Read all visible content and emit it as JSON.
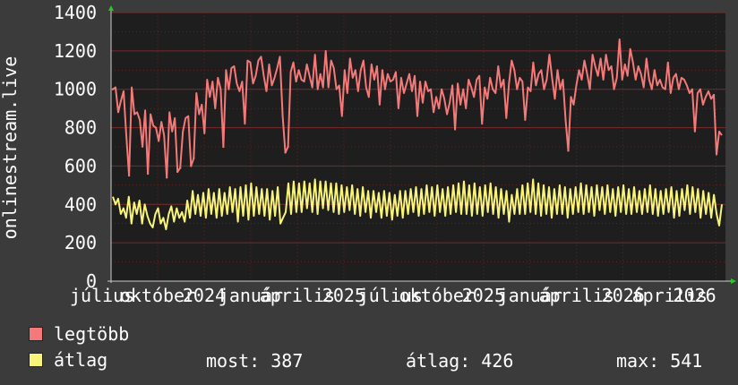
{
  "chart_data": {
    "type": "line",
    "ylabel": "onlinestream.live",
    "ylim": [
      0,
      1400
    ],
    "yticks": [
      0,
      200,
      400,
      600,
      800,
      1000,
      1200,
      1400
    ],
    "xtick_labels": [
      "július",
      "október",
      "2024",
      "január",
      "április",
      "2025",
      "július",
      "október",
      "2025",
      "január",
      "április",
      "2026",
      "április",
      "2026"
    ],
    "grid": true,
    "colors": {
      "background": "#3b3b3b",
      "plot": "#1e1e1e",
      "grid": "#7a2a2a",
      "legtobb": "#f47a7a",
      "atlag": "#f8f47a"
    },
    "series": [
      {
        "name": "legtöbb",
        "key": "legtobb",
        "values": [
          1000,
          1010,
          880,
          940,
          990,
          760,
          550,
          1010,
          870,
          880,
          840,
          700,
          890,
          560,
          870,
          810,
          800,
          730,
          830,
          760,
          540,
          880,
          780,
          850,
          570,
          590,
          780,
          850,
          860,
          600,
          640,
          980,
          870,
          920,
          770,
          1050,
          960,
          1040,
          900,
          1060,
          1000,
          700,
          1100,
          1000,
          1110,
          1120,
          1030,
          990,
          1040,
          820,
          1150,
          1140,
          1030,
          1070,
          1150,
          1170,
          1070,
          990,
          1130,
          1020,
          1060,
          1110,
          1170,
          860,
          670,
          700,
          1090,
          1140,
          1040,
          1100,
          1050,
          1040,
          1130,
          1070,
          1010,
          1180,
          1000,
          1080,
          1010,
          1200,
          1010,
          1150,
          1110,
          1000,
          1020,
          860,
          1100,
          980,
          1160,
          1060,
          1100,
          990,
          1100,
          1150,
          1010,
          960,
          1130,
          1050,
          1120,
          920,
          1100,
          1000,
          1080,
          1040,
          1050,
          1090,
          900,
          1060,
          980,
          1030,
          1080,
          990,
          1070,
          860,
          1040,
          930,
          1040,
          990,
          1000,
          880,
          960,
          900,
          1000,
          950,
          870,
          930,
          1020,
          790,
          1030,
          920,
          1000,
          900,
          1050,
          1010,
          960,
          1050,
          1070,
          820,
          1010,
          950,
          1060,
          1000,
          980,
          1120,
          1010,
          1050,
          850,
          1030,
          1150,
          1100,
          1000,
          1060,
          1040,
          840,
          1010,
          990,
          1140,
          1020,
          1080,
          1100,
          1000,
          1050,
          1180,
          1060,
          950,
          1100,
          1000,
          1050,
          840,
          680,
          960,
          920,
          1020,
          1100,
          1050,
          1150,
          1080,
          1000,
          1180,
          1120,
          1070,
          1160,
          1050,
          1180,
          1100,
          1120,
          1000,
          1060,
          1260,
          1050,
          1130,
          1070,
          1210,
          1140,
          1050,
          1120,
          1080,
          1010,
          1160,
          1050,
          1000,
          1100,
          1020,
          1050,
          1010,
          1000,
          1140,
          980,
          1060,
          1080,
          1000,
          1060,
          1050,
          1020,
          980,
          1000,
          780,
          980,
          1000,
          920,
          960,
          990,
          950,
          970,
          660,
          780,
          760
        ],
        "min_markers": [
          true,
          false,
          false,
          false,
          false,
          false,
          true,
          false,
          false,
          false,
          false,
          false,
          false,
          true,
          false,
          false,
          false,
          false,
          false,
          false,
          true,
          false,
          false,
          false,
          true,
          true,
          false,
          false,
          false,
          true,
          true,
          false,
          false,
          false,
          false,
          false,
          false,
          false,
          false,
          false,
          false,
          true,
          false,
          false,
          false,
          false,
          false,
          false,
          false,
          false,
          false,
          false,
          false,
          false,
          false,
          false,
          false,
          false,
          false,
          false,
          false,
          false,
          false,
          false,
          true,
          true,
          false,
          false,
          false,
          false,
          false,
          false,
          false,
          false,
          false,
          false,
          false,
          false,
          false,
          false,
          false,
          false,
          false,
          false,
          false,
          false,
          false,
          false,
          false,
          false,
          false,
          false,
          false,
          false,
          false,
          false,
          false,
          false,
          false,
          false,
          false,
          false,
          false,
          false,
          false,
          false,
          false,
          false,
          false,
          false,
          false,
          false,
          false,
          false,
          false,
          false,
          false,
          false,
          false,
          false,
          false,
          false,
          false,
          false,
          false,
          false,
          false,
          false,
          false,
          false,
          false,
          false,
          false,
          false,
          false,
          false,
          false,
          false,
          false,
          false,
          false,
          false,
          false,
          false,
          false,
          false,
          false,
          false,
          false,
          false,
          false,
          false,
          false,
          false,
          false,
          false,
          false,
          false,
          false,
          false,
          false,
          false,
          false,
          false,
          false,
          false,
          false,
          false,
          false,
          true,
          false,
          false,
          false,
          false,
          false,
          false,
          false,
          false,
          false,
          false,
          false,
          false,
          false,
          false,
          false,
          false,
          false,
          false,
          false,
          false,
          false,
          false,
          false,
          false,
          false,
          false,
          false,
          false,
          false,
          false,
          false,
          false,
          false,
          false,
          false,
          false,
          false,
          false,
          false,
          false,
          false,
          false,
          false,
          false,
          false,
          false,
          false,
          false,
          false,
          false,
          false,
          false,
          false,
          true,
          false,
          false
        ]
      },
      {
        "name": "átlag",
        "key": "atlag",
        "values": [
          440,
          400,
          430,
          350,
          380,
          330,
          440,
          300,
          410,
          350,
          420,
          300,
          400,
          340,
          300,
          280,
          350,
          380,
          300,
          330,
          270,
          350,
          390,
          310,
          380,
          330,
          360,
          310,
          420,
          330,
          470,
          350,
          450,
          340,
          460,
          330,
          480,
          350,
          460,
          330,
          480,
          340,
          460,
          350,
          490,
          360,
          480,
          310,
          490,
          340,
          500,
          320,
          510,
          340,
          490,
          350,
          480,
          340,
          480,
          320,
          470,
          340,
          490,
          300,
          330,
          360,
          510,
          350,
          520,
          360,
          510,
          360,
          520,
          380,
          510,
          360,
          530,
          350,
          520,
          380,
          520,
          370,
          510,
          360,
          510,
          350,
          500,
          360,
          490,
          370,
          500,
          350,
          480,
          340,
          490,
          360,
          470,
          330,
          470,
          360,
          460,
          330,
          470,
          340,
          460,
          320,
          450,
          340,
          470,
          330,
          470,
          350,
          480,
          360,
          490,
          340,
          480,
          350,
          500,
          360,
          490,
          340,
          500,
          360,
          480,
          340,
          490,
          350,
          500,
          360,
          510,
          350,
          520,
          350,
          500,
          340,
          510,
          350,
          490,
          340,
          500,
          360,
          510,
          350,
          490,
          330,
          480,
          350,
          470,
          310,
          450,
          350,
          480,
          350,
          500,
          350,
          510,
          360,
          530,
          350,
          510,
          340,
          500,
          350,
          490,
          330,
          480,
          350,
          500,
          350,
          490,
          330,
          480,
          350,
          490,
          360,
          510,
          350,
          500,
          360,
          490,
          340,
          500,
          370,
          490,
          350,
          500,
          360,
          480,
          340,
          490,
          360,
          500,
          350,
          480,
          350,
          490,
          360,
          470,
          350,
          480,
          360,
          500,
          350,
          480,
          340,
          470,
          350,
          480,
          360,
          490,
          330,
          470,
          340,
          480,
          370,
          500,
          350,
          490,
          360,
          480,
          330,
          470,
          350,
          460,
          330,
          450,
          350,
          290,
          400
        ]
      }
    ]
  },
  "legend": [
    {
      "label": "legtöbb",
      "color": "#f47a7a"
    },
    {
      "label": "átlag",
      "color": "#f8f47a"
    }
  ],
  "stats": {
    "most_label": "most:",
    "most_value": "387",
    "atlag_label": "átlag:",
    "atlag_value": "426",
    "max_label": "max:",
    "max_value": "541"
  }
}
